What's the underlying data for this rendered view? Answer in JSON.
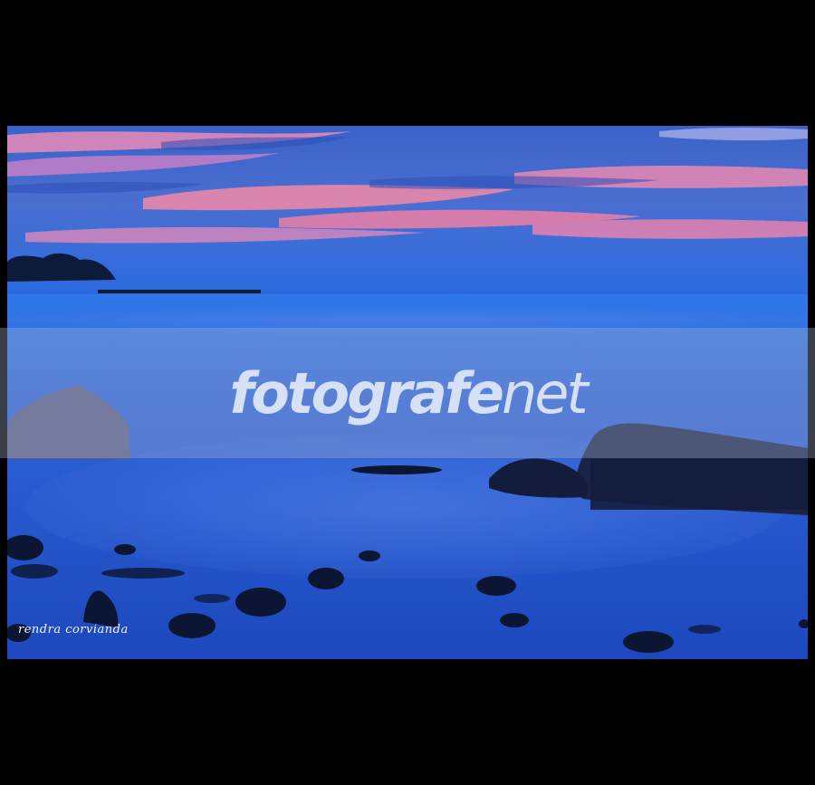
{
  "photo": {
    "subject": "seascape-at-dusk",
    "colors": {
      "frame": "#000000",
      "sky_top": "#3a6bd6",
      "cloud_pink": "#f07aa8",
      "horizon": "#2b6fe0",
      "sea": "#2a5fd8",
      "sea_deep": "#1b44b8",
      "rock": "#0d1733"
    }
  },
  "watermark": {
    "brand": "fotografe",
    "suffix": "net"
  },
  "signature": "rendra corvianda"
}
